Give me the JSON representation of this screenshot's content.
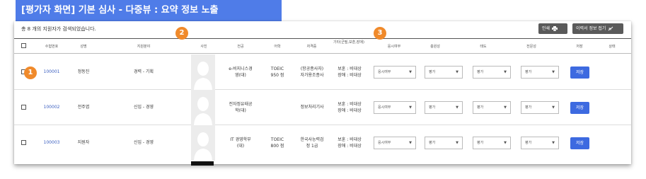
{
  "banner": {
    "title": "[평가자 화면] 기본 심사 - 다중뷰 : 요약 정보 노출"
  },
  "toolbar": {
    "count_text": "총 8 개의 지원자가 검색되었습니다.",
    "print_label": "인쇄",
    "print_icon": "printer-icon",
    "collapse_label": "이력서 정보 접기",
    "collapse_icon": "collapse-arrows-icon"
  },
  "badges": [
    "1",
    "2",
    "3"
  ],
  "table": {
    "headers": [
      "수험번호",
      "성명",
      "지원분야",
      "사진",
      "전공",
      "어학",
      "자격증",
      "기타(군필,보훈,장애)",
      "응시여부",
      "충원성",
      "태도",
      "전문성",
      "저장",
      "상태"
    ],
    "rows": [
      {
        "id": "100001",
        "name": "정동진",
        "field": "경력 - 기획",
        "major": [
          "e-비지니스경",
          "영(대)"
        ],
        "language": [
          "TOEIC",
          "950 점"
        ],
        "cert": [
          "(항공종사자)",
          "자가용조종사"
        ],
        "etc": [
          "보훈 : 비대상",
          "장애 : 비대상"
        ],
        "attend": "응시여부",
        "eval1": "평가",
        "eval2": "평가",
        "eval3": "평가",
        "save": "저장"
      },
      {
        "id": "100002",
        "name": "전주엽",
        "field": "신입 - 경영",
        "major": [
          "전자정유태공",
          "학(대)"
        ],
        "language": [
          "",
          ""
        ],
        "cert": [
          "정보처리기사",
          ""
        ],
        "etc": [
          "보훈 : 비대상",
          "장애 : 비대상"
        ],
        "attend": "응시여부",
        "eval1": "평가",
        "eval2": "평가",
        "eval3": "평가",
        "save": "저장"
      },
      {
        "id": "100003",
        "name": "지원자",
        "field": "신입 - 경영",
        "major": [
          "IT 경영학부",
          "(대)"
        ],
        "language": [
          "TOEIC",
          "800 점"
        ],
        "cert": [
          "한국사능력검",
          "정 1급"
        ],
        "etc": [
          "보훈 : 비대상",
          "장애 : 비대상"
        ],
        "attend": "응시여부",
        "eval1": "평가",
        "eval2": "평가",
        "eval3": "평가",
        "save": "저장"
      }
    ]
  },
  "colors": {
    "banner": "#4f7ce8",
    "badge": "#f08a2b",
    "save_button": "#3d6ae0",
    "dark_button": "#5a5a5a",
    "link": "#3b5fc0"
  }
}
